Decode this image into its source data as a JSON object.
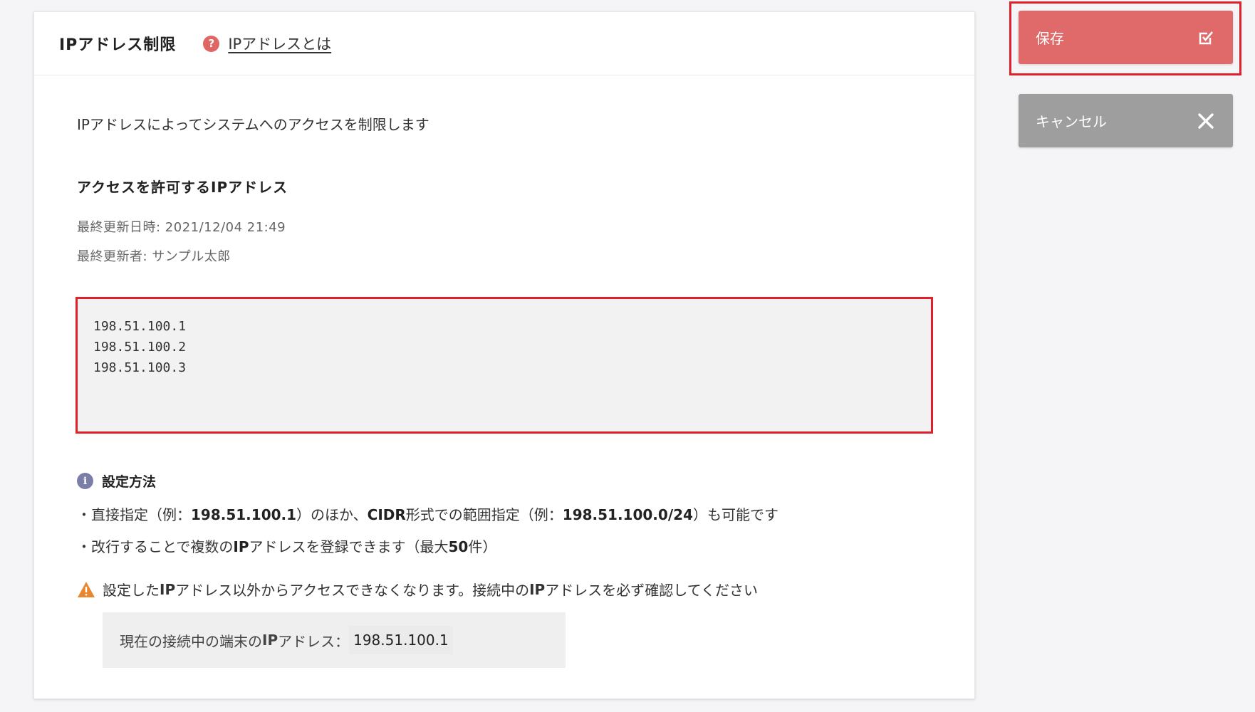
{
  "header": {
    "title": "IPアドレス制限",
    "help_icon": "question-icon",
    "help_link": "IPアドレスとは"
  },
  "main": {
    "description": "IPアドレスによってシステムへのアクセスを制限します",
    "section_title": "アクセスを許可するIPアドレス",
    "last_updated": "最終更新日時: 2021/12/04 21:49",
    "last_updated_by": "最終更新者: サンプル太郎",
    "ip_list": "198.51.100.1\n198.51.100.2\n198.51.100.3",
    "info": {
      "icon": "info-icon",
      "heading": "設定方法",
      "bullet1_parts": [
        "・直接指定（例：",
        "198.51.100.1",
        "）のほか、",
        "CIDR",
        "形式での範囲指定（例：",
        "198.51.100.0/24",
        "）も可能です"
      ],
      "bullet2_parts": [
        "・改行することで複数の",
        "IP",
        "アドレスを登録できます（最大",
        "50",
        "件）"
      ]
    },
    "warning": {
      "icon": "warning-icon",
      "parts": [
        "設定した",
        "IP",
        "アドレス以外からアクセスできなくなります。接続中の",
        "IP",
        "アドレスを必ず確認してください"
      ]
    },
    "current_ip": {
      "label_parts": [
        "現在の接続中の端末の",
        "IP",
        "アドレス："
      ],
      "value": "198.51.100.1"
    }
  },
  "actions": {
    "save_label": "保存",
    "save_icon": "checkbox-check-icon",
    "cancel_label": "キャンセル",
    "cancel_icon": "close-icon"
  },
  "colors": {
    "save_button": "#e06a6a",
    "cancel_button": "#9e9e9e",
    "highlight_border": "#e0202a",
    "help_icon": "#e06666",
    "info_icon": "#7b7fa8",
    "warning_icon": "#e8872f"
  }
}
